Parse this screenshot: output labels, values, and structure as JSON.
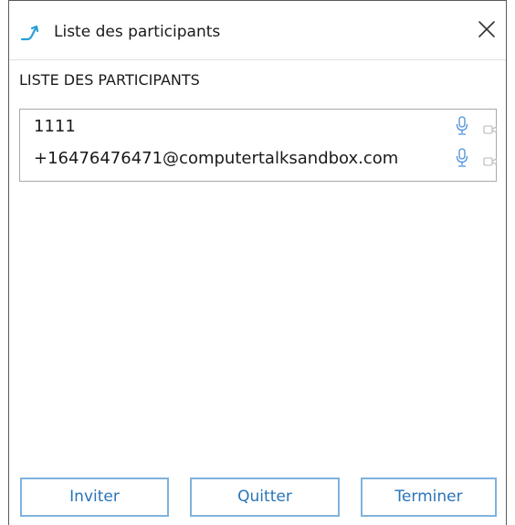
{
  "window": {
    "title": "Liste des participants",
    "title_icon": "call-arrow-icon",
    "close_icon": "close-icon"
  },
  "section": {
    "header": "LISTE DES PARTICIPANTS"
  },
  "participants": [
    {
      "name": "1111",
      "mic": "microphone-icon",
      "camera": "camera-icon"
    },
    {
      "name": "+16476476471@computertalksandbox.com",
      "mic": "microphone-icon",
      "camera": "camera-icon"
    }
  ],
  "buttons": {
    "invite": "Inviter",
    "quit": "Quitter",
    "end": "Terminer"
  },
  "colors": {
    "accent": "#2a74b8",
    "button_border": "#7fb2de",
    "mic": "#4a90d9",
    "camera": "#b8b8b8"
  }
}
